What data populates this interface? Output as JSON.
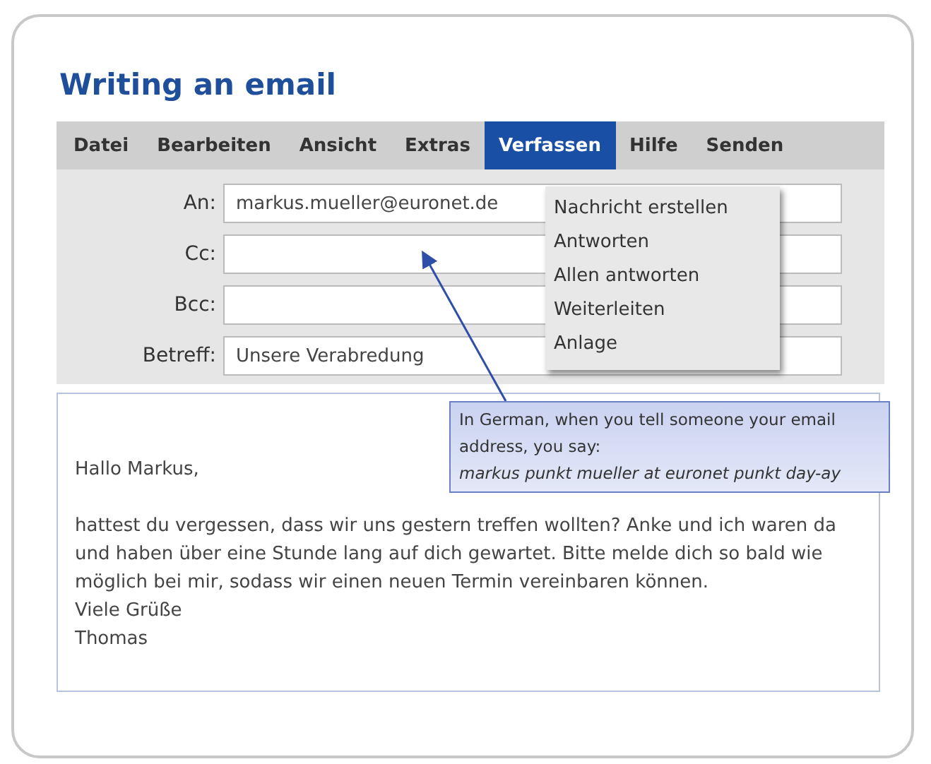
{
  "title": "Writing an email",
  "menu": [
    {
      "label": "Datei",
      "selected": false
    },
    {
      "label": "Bearbeiten",
      "selected": false
    },
    {
      "label": "Ansicht",
      "selected": false
    },
    {
      "label": "Extras",
      "selected": false
    },
    {
      "label": "Verfassen",
      "selected": true
    },
    {
      "label": "Hilfe",
      "selected": false
    },
    {
      "label": "Senden",
      "selected": false
    }
  ],
  "dropdown": [
    "Nachricht erstellen",
    "Antworten",
    "Allen antworten",
    "Weiterleiten",
    "Anlage"
  ],
  "fields": [
    {
      "label": "An:",
      "value": "markus.mueller@euronet.de"
    },
    {
      "label": "Cc:"
    },
    {
      "label": "Bcc:"
    },
    {
      "label": "Betreff:",
      "value": "Unsere Verabredung"
    }
  ],
  "callout": "In German, when you tell someone your email address, you say: *markus punkt mueller at euronet punkt day-ay*",
  "body": {
    "greeting": "Hallo Markus,",
    "paragraph": "hattest du vergessen, dass wir uns gestern treffen wollten? Anke und ich waren da und haben über eine Stunde lang auf dich gewartet. Bitte melde dich so bald wie möglich bei mir, sodass wir einen neuen Termin vereinbaren können.",
    "closing": [
      "Viele Grüße",
      "Thomas"
    ]
  }
}
